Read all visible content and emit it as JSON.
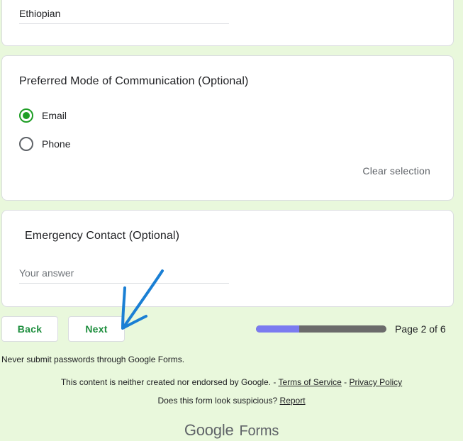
{
  "nationality": {
    "value": "Ethiopian"
  },
  "communication": {
    "title": "Preferred Mode of Communication (Optional)",
    "options": [
      {
        "label": "Email",
        "checked": true
      },
      {
        "label": "Phone",
        "checked": false
      }
    ],
    "clear_label": "Clear selection"
  },
  "emergency": {
    "title": "Emergency Contact (Optional)",
    "placeholder": "Your answer"
  },
  "nav": {
    "back_label": "Back",
    "next_label": "Next",
    "page_indicator": "Page 2 of 6",
    "progress_fraction": 0.333
  },
  "footer": {
    "password_warning": "Never submit passwords through Google Forms.",
    "disclaimer_prefix": "This content is neither created nor endorsed by Google. -",
    "terms_label": "Terms of Service",
    "separator": "-",
    "privacy_label": "Privacy Policy",
    "suspicious_prefix": "Does this form look suspicious?",
    "report_label": "Report",
    "logo_google": "Google",
    "logo_forms": "Forms"
  },
  "colors": {
    "background": "#e9f8dc",
    "accent": "#1e9e25",
    "progress_fill": "#7b7bf0",
    "progress_track": "#6b6b6b",
    "annotation_arrow": "#1a7fd4"
  },
  "icons": {
    "annotation": "blue-hand-drawn-arrow-icon"
  }
}
